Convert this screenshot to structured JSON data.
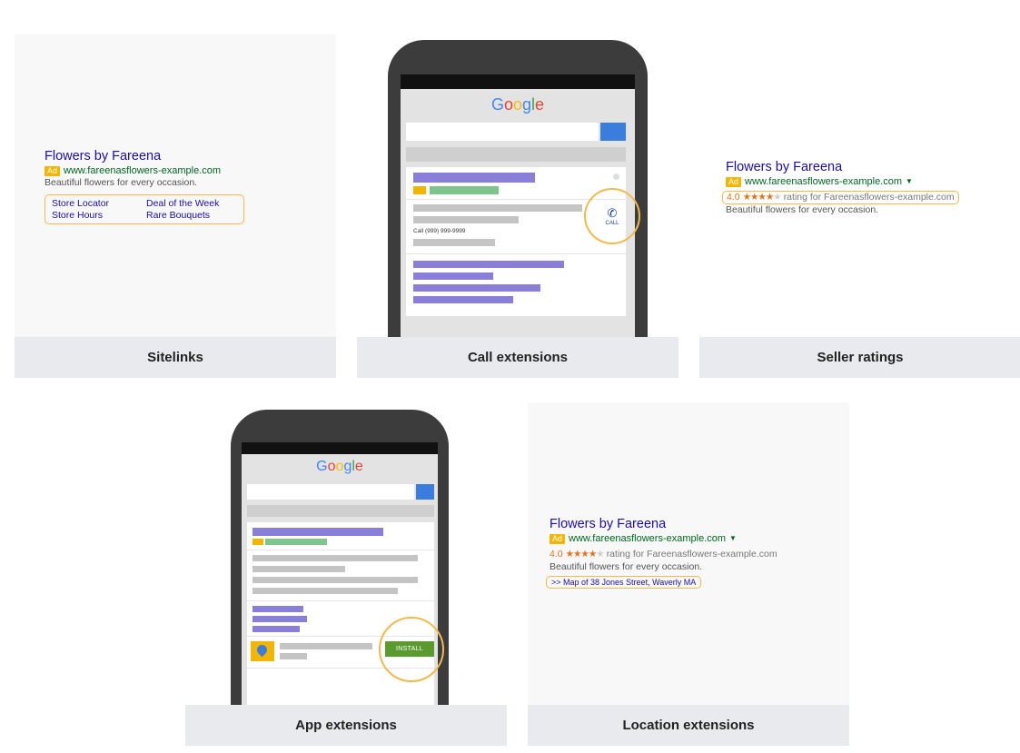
{
  "brand_color": "#1a0dab",
  "url_color": "#006621",
  "highlight_color": "#f2b94b",
  "ad": {
    "title": "Flowers by Fareena",
    "badge": "Ad",
    "url": "www.fareenasflowers-example.com",
    "description": "Beautiful flowers for every occasion.",
    "rating_value": "4.0",
    "rating_stars": 4,
    "rating_text": "rating for Fareenasflowers-example.com",
    "map_link": ">> Map of 38 Jones Street, Waverly MA"
  },
  "sitelinks": [
    "Store Locator",
    "Deal of the Week",
    "Store Hours",
    "Rare Bouquets"
  ],
  "phone": {
    "logo": [
      "G",
      "o",
      "o",
      "g",
      "l",
      "e"
    ],
    "call_number": "Call (999) 999-9999",
    "call_label": "CALL",
    "call_icon": "phone-icon",
    "install_label": "INSTALL",
    "app_icon": "map-pin-icon"
  },
  "captions": {
    "sitelinks": "Sitelinks",
    "call": "Call extensions",
    "seller": "Seller ratings",
    "app": "App extensions",
    "location": "Location extensions"
  }
}
